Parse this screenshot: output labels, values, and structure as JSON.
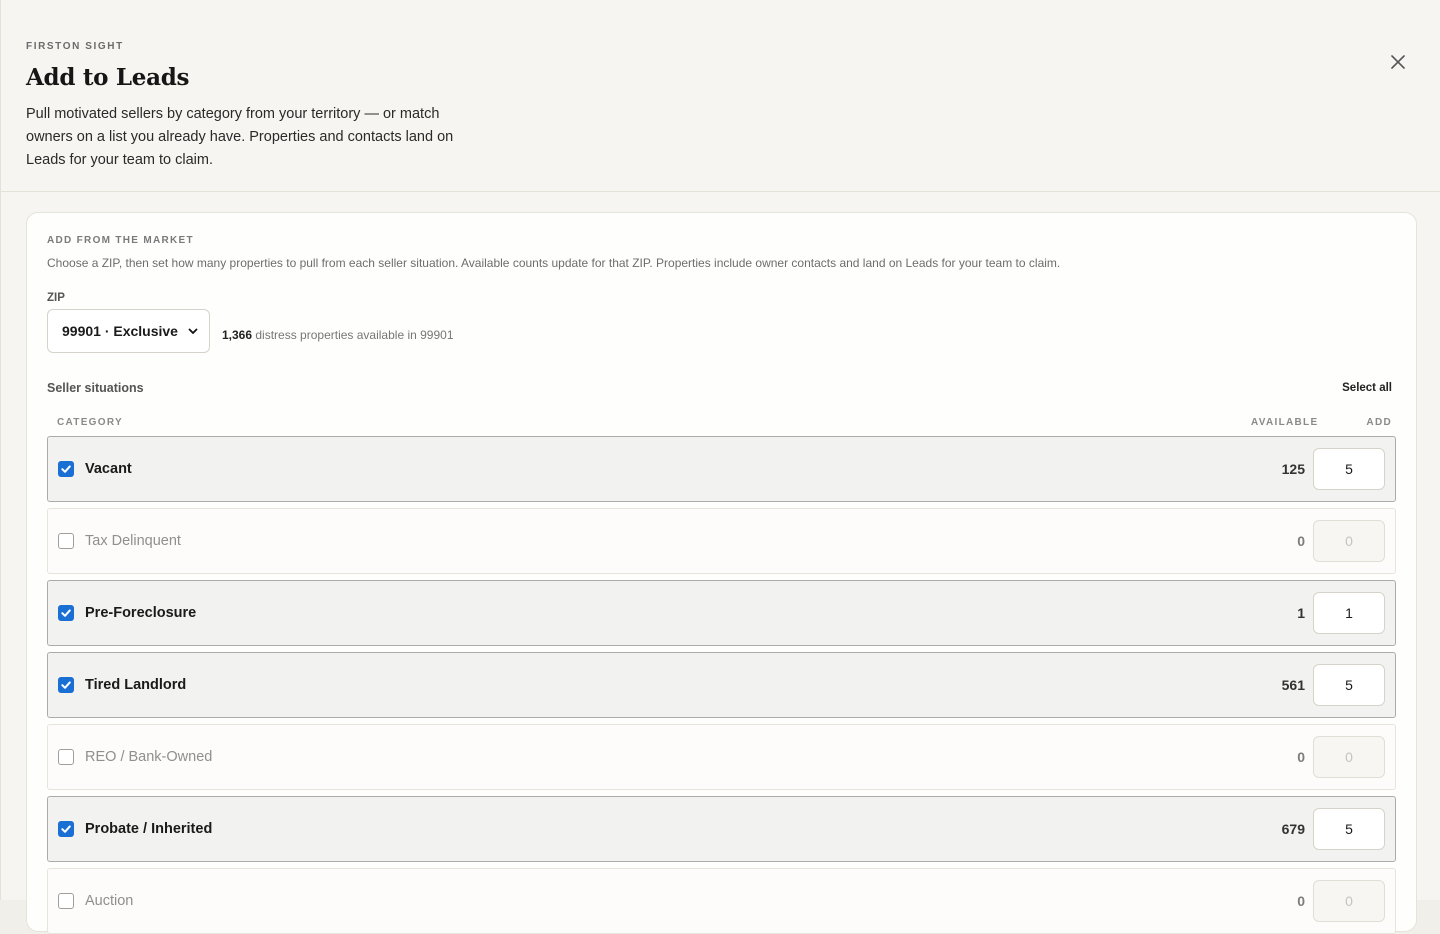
{
  "header": {
    "eyebrow": "FIRSTON SIGHT",
    "title": "Add to Leads",
    "description": "Pull motivated sellers by category from your territory — or match owners on a list you already have. Properties and contacts land on Leads for your team to claim."
  },
  "section": {
    "eyebrow": "ADD FROM THE MARKET",
    "description": "Choose a ZIP, then set how many properties to pull from each seller situation. Available counts update for that ZIP. Properties include owner contacts and land on Leads for your team to claim.",
    "zip_label": "ZIP",
    "zip_value": "99901 · Exclusive",
    "zip_count": "1,366",
    "zip_info_suffix": "distress properties available in 99901",
    "situations_label": "Seller situations",
    "select_all": "Select all",
    "columns": {
      "category": "CATEGORY",
      "available": "AVAILABLE",
      "add": "ADD"
    }
  },
  "rows": [
    {
      "label": "Vacant",
      "available": "125",
      "add": "5",
      "checked": true
    },
    {
      "label": "Tax Delinquent",
      "available": "0",
      "add": "0",
      "checked": false
    },
    {
      "label": "Pre-Foreclosure",
      "available": "1",
      "add": "1",
      "checked": true
    },
    {
      "label": "Tired Landlord",
      "available": "561",
      "add": "5",
      "checked": true
    },
    {
      "label": "REO / Bank-Owned",
      "available": "0",
      "add": "0",
      "checked": false
    },
    {
      "label": "Probate / Inherited",
      "available": "679",
      "add": "5",
      "checked": true
    },
    {
      "label": "Auction",
      "available": "0",
      "add": "0",
      "checked": false
    }
  ],
  "colors": {
    "accent": "#1a6fd4",
    "background": "#f6f5f1"
  }
}
